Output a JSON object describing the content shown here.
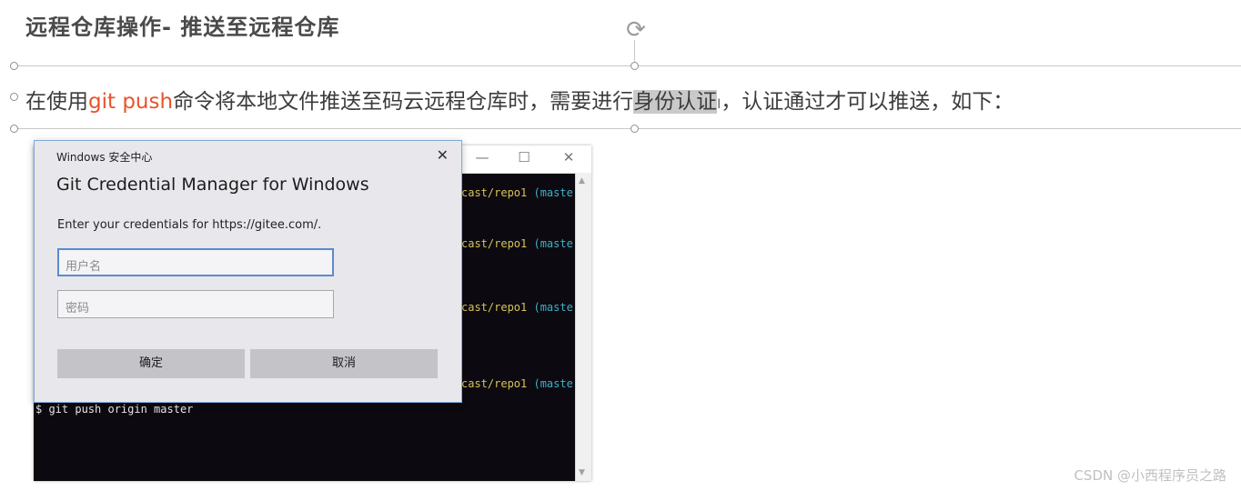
{
  "slide": {
    "title": "远程仓库操作- 推送至远程仓库",
    "text_before": "在使用",
    "text_command": "git push",
    "text_middle": "命令将本地文件推送至码云远程仓库时，需要进行",
    "text_selected": "身份认证",
    "text_after": "，认证通过才可以推送，如下：",
    "accent_color": "#e8542a"
  },
  "terminal": {
    "controls": [
      "—",
      "☐",
      "✕"
    ],
    "lines": [
      {
        "path": "cast/repo1",
        "branch": "(maste"
      },
      {
        "path": "cast/repo1",
        "branch": "(maste"
      },
      {
        "path": "cast/repo1",
        "branch": "(maste"
      },
      {
        "path": "cast/repo1",
        "branch": "(maste"
      }
    ],
    "command": "$ git push origin master"
  },
  "dialog": {
    "caption": "Windows 安全中心",
    "close_icon": "close-icon",
    "title": "Git Credential Manager for Windows",
    "description": "Enter your credentials for https://gitee.com/.",
    "username_placeholder": "用户名",
    "password_placeholder": "密码",
    "ok_label": "确定",
    "cancel_label": "取消"
  },
  "watermark": "CSDN @小西程序员之路"
}
